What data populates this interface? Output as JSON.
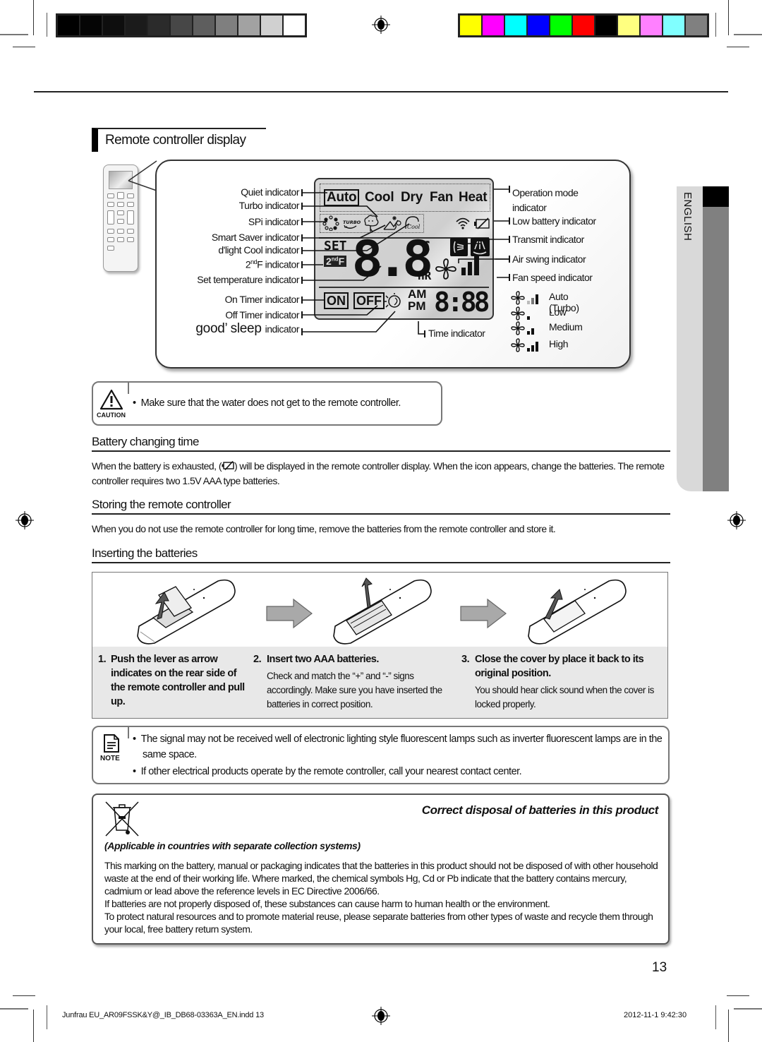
{
  "print_marks": {
    "grayscale_swatches": [
      "#000000",
      "#050505",
      "#0e0e0e",
      "#1b1b1b",
      "#2b2b2b",
      "#474747",
      "#5e5e5e",
      "#7f7f7f",
      "#a2a2a2",
      "#d0d0d0",
      "#ffffff"
    ],
    "color_swatches": [
      "#ffff00",
      "#ff00ff",
      "#00ffff",
      "#0000ff",
      "#00ff00",
      "#ff0000",
      "#000000",
      "#ffff80",
      "#ff80ff",
      "#80ffff",
      "#808080"
    ]
  },
  "section": {
    "title": "Remote controller display"
  },
  "display": {
    "left_labels": [
      {
        "text": "Quiet indicator"
      },
      {
        "text": "Turbo indicator"
      },
      {
        "text": "SPi indicator"
      },
      {
        "text": "Smart Saver indicator"
      },
      {
        "text": "d'light Cool indicator"
      },
      {
        "text_pre": "2",
        "text_sup": "nd",
        "text_post": "F indicator"
      },
      {
        "text": "Set temperature indicator"
      },
      {
        "text": "On Timer indicator"
      },
      {
        "text": "Off Timer indicator"
      },
      {
        "brand": "good’ sleep",
        "text": "indicator"
      }
    ],
    "right_labels": [
      {
        "text": "Operation mode indicator"
      },
      {
        "text": "Low battery indicator"
      },
      {
        "text": "Transmit indicator"
      },
      {
        "text": "Air swing indicator"
      },
      {
        "text": "Fan speed indicator"
      }
    ],
    "time_label": "Time indicator",
    "fan_speeds": [
      {
        "label": "Auto (Turbo)",
        "bars": 3,
        "style": "auto"
      },
      {
        "label": "Low",
        "bars": 1,
        "style": "solid"
      },
      {
        "label": "Medium",
        "bars": 2,
        "style": "solid"
      },
      {
        "label": "High",
        "bars": 3,
        "style": "solid"
      }
    ],
    "lcd": {
      "modes": [
        "Auto",
        "Cool",
        "Dry",
        "Fan",
        "Heat"
      ],
      "active_mode": "Auto",
      "turbo_text": "TURBO",
      "cool_script": "Cool",
      "set_text": "SET",
      "second_f_pre": "2",
      "second_f_sup": "nd",
      "second_f_post": "F",
      "temp_digits": "8.8",
      "unit": "°C",
      "hr": "HR",
      "on": "ON",
      "off": "OFF",
      "am": "AM",
      "pm": "PM",
      "time_digits": "8:88"
    }
  },
  "language_tab": "ENGLISH",
  "caution": {
    "label": "CAUTION",
    "icon": "warning-triangle-icon",
    "bullets": [
      "Make sure that the water does not get to the remote controller."
    ]
  },
  "battery_changing": {
    "heading": "Battery changing time",
    "text_before_icon": "When the battery is exhausted, (",
    "icon": "low-battery-icon",
    "text_after_icon": ") will be displayed in the remote controller display. When the icon appears, change the batteries. The remote controller requires two 1.5V AAA type batteries."
  },
  "storing": {
    "heading": "Storing the remote controller",
    "text": "When you do not use the remote controller for long time, remove the batteries from the remote controller and store it."
  },
  "inserting": {
    "heading": "Inserting the batteries",
    "steps": [
      {
        "num": "1.",
        "title": "Push the lever as arrow indicates on the rear side of the remote controller and pull up.",
        "body": ""
      },
      {
        "num": "2.",
        "title": "Insert two AAA batteries.",
        "body": "Check and match the “+” and “-” signs accordingly. Make sure you have inserted the batteries in correct position."
      },
      {
        "num": "3.",
        "title": "Close the cover by place it back to its original position.",
        "body": "You should hear click sound when the cover is locked properly."
      }
    ]
  },
  "note": {
    "label": "NOTE",
    "icon": "note-icon",
    "bullets": [
      "The signal may not be received well of electronic lighting style fluorescent lamps such as inverter fluorescent lamps are in the same space.",
      "If other electrical products operate by the remote controller, call your nearest contact center."
    ]
  },
  "disposal": {
    "icon": "crossed-bin-icon",
    "title": "Correct disposal of batteries in this product",
    "subtitle": "(Applicable in  countries with separate collection systems)",
    "paragraphs": [
      "This marking on the battery, manual or packaging indicates that the batteries in this product should not be disposed of with other household waste at the end of their working life. Where marked, the chemical symbols Hg, Cd or Pb indicate that the battery contains mercury, cadmium or lead above the reference levels in EC Directive 2006/66.",
      "If batteries are not properly disposed of, these substances can cause harm to human health or the environment.",
      "To protect natural resources and to promote material reuse, please separate batteries from other types of waste and recycle them through your local, free battery return system."
    ]
  },
  "page_number": "13",
  "footer": {
    "file": "Junfrau EU_AR09FSSK&Y@_IB_DB68-03363A_EN.indd   13",
    "timestamp": "2012-11-1   9:42:30"
  }
}
